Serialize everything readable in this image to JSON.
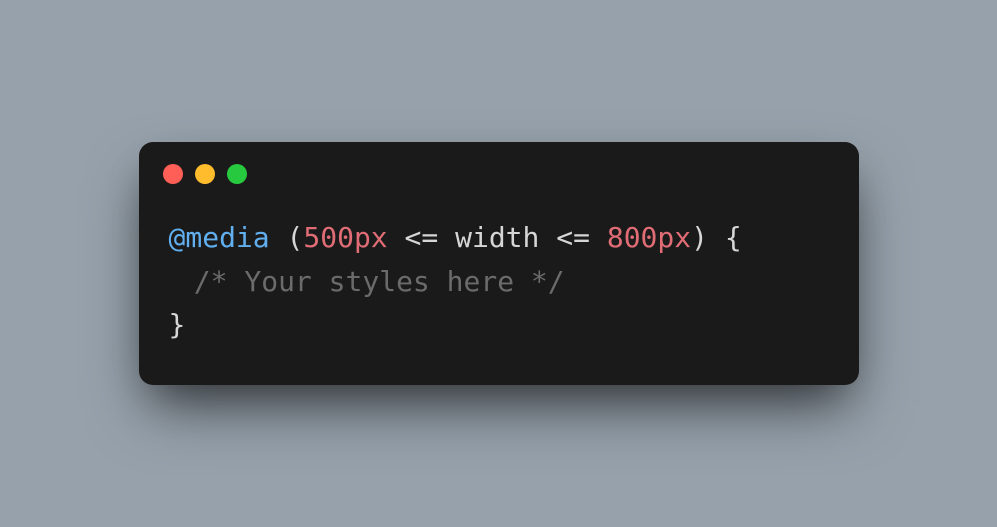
{
  "code": {
    "line1": {
      "atrule": "@media",
      "paren_open": "(",
      "value1": "500px",
      "op1": "<=",
      "ident": "width",
      "op2": "<=",
      "value2": "800px",
      "paren_close": ")",
      "brace_open": "{"
    },
    "line2": {
      "comment": "/* Your styles here */"
    },
    "line3": {
      "brace_close": "}"
    }
  }
}
